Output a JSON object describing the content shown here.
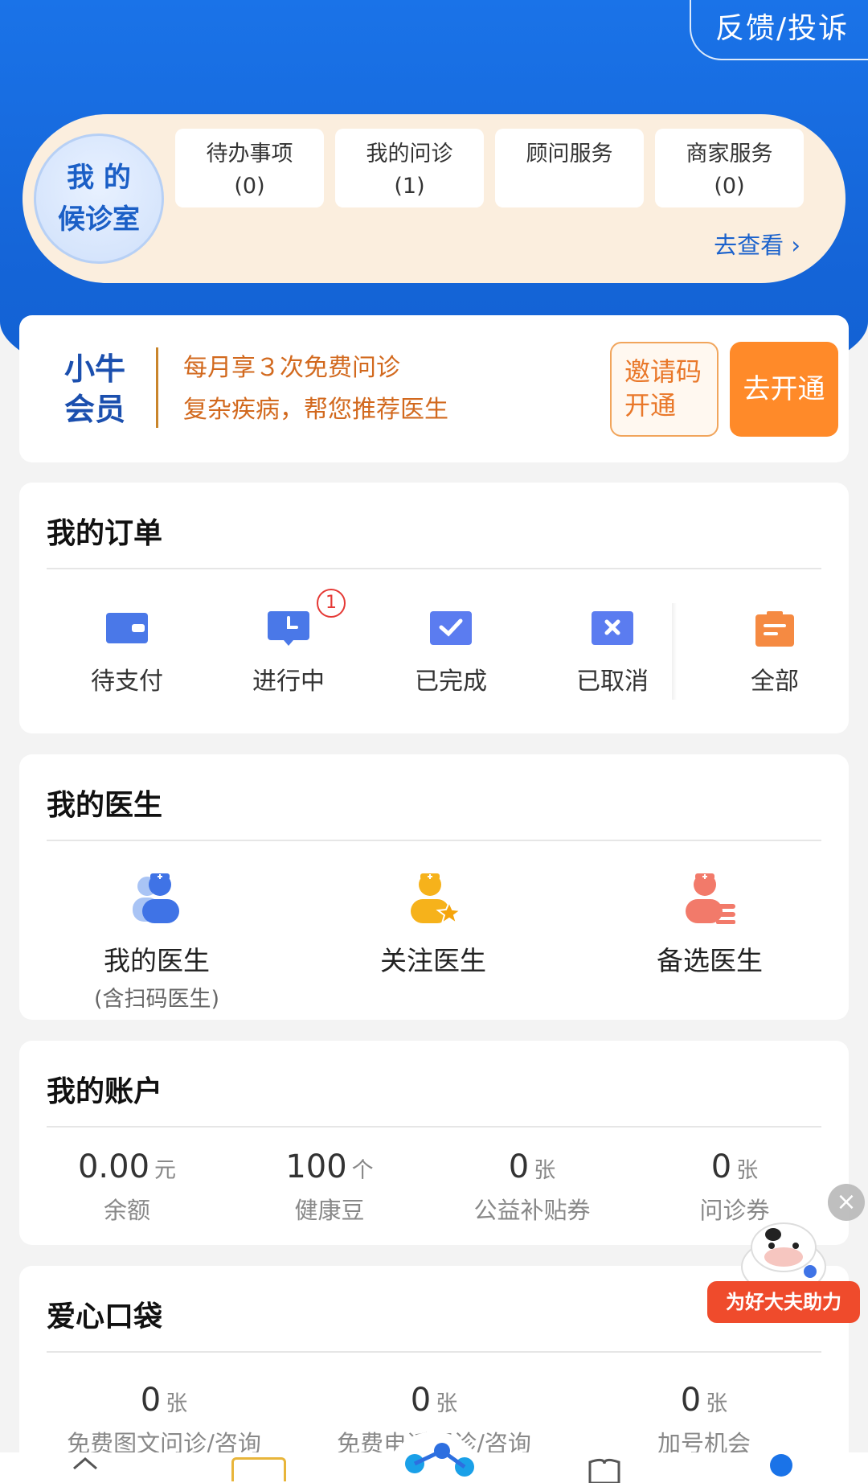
{
  "header": {
    "feedback_label": "反馈/投诉"
  },
  "waiting_room": {
    "title_line1": "我 的",
    "title_line2": "候诊室",
    "tiles": [
      {
        "label": "待办事项",
        "count": "(0)"
      },
      {
        "label": "我的问诊",
        "count": "(1)"
      },
      {
        "label": "顾问服务",
        "count": ""
      },
      {
        "label": "商家服务",
        "count": "(0)"
      }
    ],
    "view_link": "去查看 ›"
  },
  "membership": {
    "title_line1": "小牛",
    "title_line2": "会员",
    "desc_line1": "每月享３次免费问诊",
    "desc_line2": "复杂疾病，帮您推荐医生",
    "invite_line1": "邀请码",
    "invite_line2": "开通",
    "open_label": "去开通"
  },
  "orders": {
    "title": "我的订单",
    "items": [
      {
        "label": "待支付",
        "icon": "wallet-icon"
      },
      {
        "label": "进行中",
        "icon": "clock-icon",
        "badge": "1"
      },
      {
        "label": "已完成",
        "icon": "check-icon"
      },
      {
        "label": "已取消",
        "icon": "cancel-icon"
      },
      {
        "label": "全部",
        "icon": "clipboard-icon"
      }
    ]
  },
  "doctors": {
    "title": "我的医生",
    "items": [
      {
        "label": "我的医生",
        "sub": "(含扫码医生)",
        "icon": "doctor-icon"
      },
      {
        "label": "关注医生",
        "sub": "",
        "icon": "doctor-star-icon"
      },
      {
        "label": "备选医生",
        "sub": "",
        "icon": "doctor-list-icon"
      }
    ]
  },
  "account": {
    "title": "我的账户",
    "items": [
      {
        "value": "0.00",
        "unit": "元",
        "label": "余额"
      },
      {
        "value": "100",
        "unit": "个",
        "label": "健康豆"
      },
      {
        "value": "0",
        "unit": "张",
        "label": "公益补贴券"
      },
      {
        "value": "0",
        "unit": "张",
        "label": "问诊券"
      }
    ]
  },
  "pocket": {
    "title": "爱心口袋",
    "items": [
      {
        "value": "0",
        "unit": "张",
        "label": "免费图文问诊/咨询"
      },
      {
        "value": "0",
        "unit": "张",
        "label": "免费电话问诊/咨询"
      },
      {
        "value": "0",
        "unit": "张",
        "label": "加号机会"
      }
    ]
  },
  "promo": {
    "label": "为好大夫助力"
  },
  "colors": {
    "brand_blue": "#1a73e8",
    "accent_orange": "#ff8a29",
    "badge_red": "#e53935"
  }
}
